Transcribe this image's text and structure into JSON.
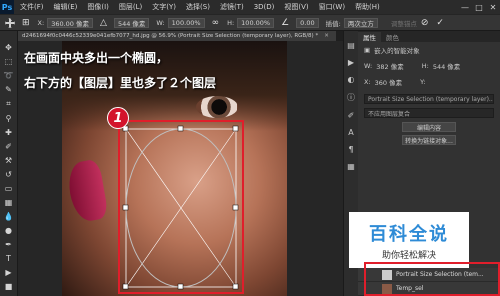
{
  "menubar": {
    "logo": "Ps",
    "items": [
      "文件(F)",
      "编辑(E)",
      "图像(I)",
      "图层(L)",
      "文字(Y)",
      "选择(S)",
      "滤镜(T)",
      "3D(D)",
      "视图(V)",
      "窗口(W)",
      "帮助(H)"
    ],
    "controls": [
      "—",
      "□",
      "✕"
    ]
  },
  "options": {
    "x_label": "X:",
    "x_value": "360.00 像素",
    "w_label": "W:",
    "w_value": "100.00%",
    "h_label": "H:",
    "h_value": "100.00%",
    "angle_value": "0.00",
    "interp_label": "插值:",
    "interp_value": "两次立方",
    "warp_label": "调整锚点",
    "cancel_icon": "⊘",
    "commit_icon": "✓"
  },
  "document": {
    "tab_title": "d2461694f0c0446c52339e041efb7077_hd.jpg @ 56.9% (Portrait Size Selection (temporary layer), RGB/8) *",
    "close": "✕"
  },
  "annotation": {
    "line1": "在画面中央多出一个椭圆，",
    "line2": "右下方的【图层】里也多了２个图层",
    "badge": "1"
  },
  "properties": {
    "tabs": [
      "属性",
      "颜色"
    ],
    "smart_object_label": "嵌入的智能对象",
    "w_label": "W:",
    "w_value": "382 像素",
    "h_label": "H:",
    "h_value": "544 像素",
    "x_label": "X:",
    "x_value": "360 像素",
    "y_label": "Y:",
    "y_value": "",
    "layer_name_box": "Portrait Size Selection (temporary layer)...",
    "comp_box": "不应用图层复合",
    "edit_button": "编辑内容",
    "convert_button": "转换为链接对象..."
  },
  "watermark": {
    "main": "百科全说",
    "sub": "助你轻松解决"
  },
  "layers": {
    "rows": [
      "Portrait Size Selection (tem...",
      "Temp_sel"
    ]
  }
}
